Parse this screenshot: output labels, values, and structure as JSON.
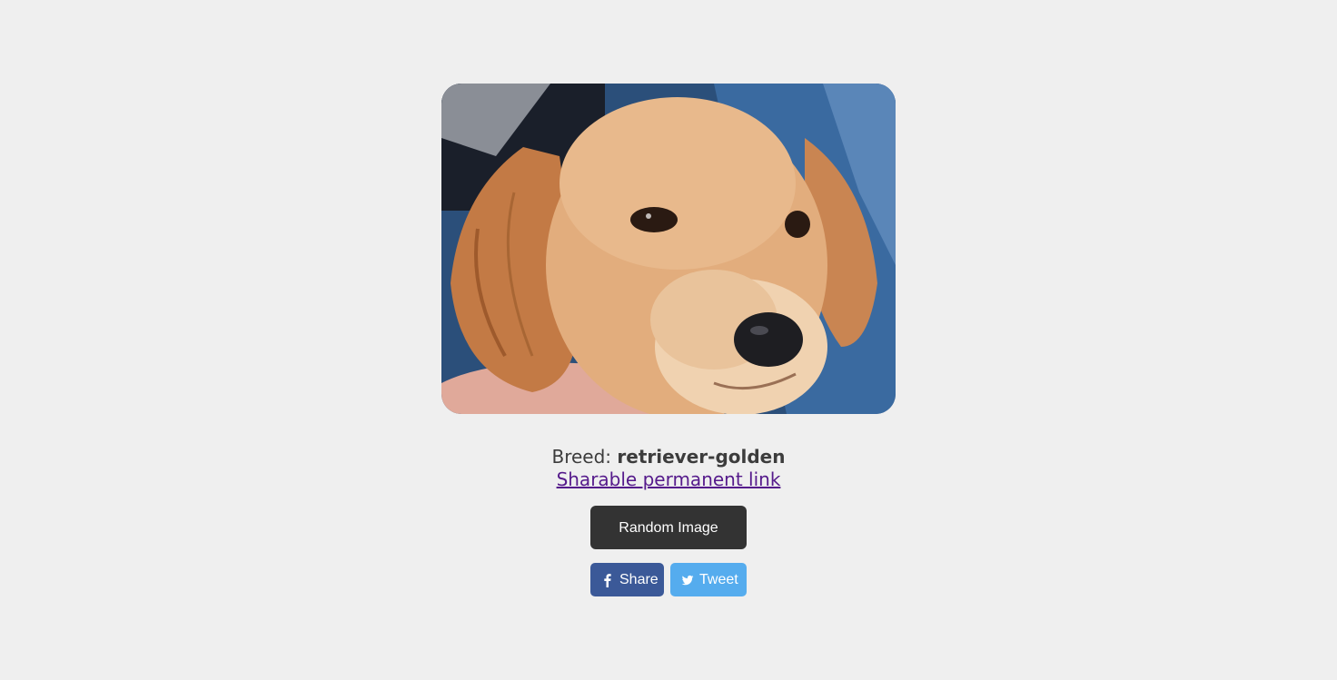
{
  "image": {
    "alt": "retriever-golden",
    "subject": "golden retriever puppy"
  },
  "breed": {
    "label": "Breed:",
    "value": "retriever-golden"
  },
  "permalink": {
    "text": "Sharable permanent link"
  },
  "buttons": {
    "random": "Random Image",
    "facebook": "Share",
    "twitter": "Tweet"
  },
  "icons": {
    "facebook": "facebook-icon",
    "twitter": "twitter-icon"
  },
  "colors": {
    "background": "#efefef",
    "random_button": "#333333",
    "facebook": "#3b5998",
    "twitter": "#55acee",
    "link": "#551a8b"
  }
}
